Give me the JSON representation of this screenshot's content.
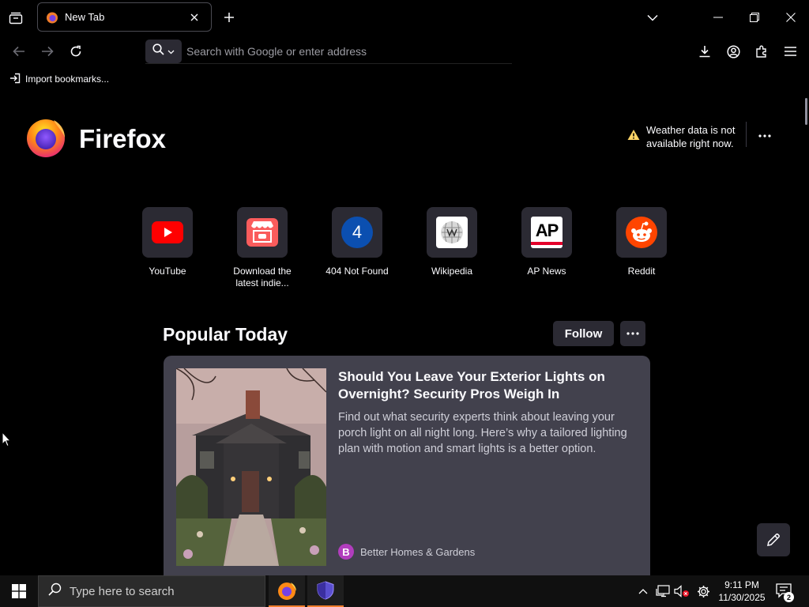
{
  "tabs": [
    {
      "title": "New Tab"
    }
  ],
  "urlbar": {
    "placeholder": "Search with Google or enter address"
  },
  "bookmarks": {
    "import_label": "Import bookmarks..."
  },
  "brand": {
    "wordmark": "Firefox"
  },
  "weather": {
    "message": "Weather data is not available right now."
  },
  "shortcuts": [
    {
      "label": "YouTube",
      "icon": "youtube-icon"
    },
    {
      "label": "Download the latest indie...",
      "icon": "store-icon"
    },
    {
      "label": "404 Not Found",
      "icon": "letter-4-icon",
      "glyph": "4"
    },
    {
      "label": "Wikipedia",
      "icon": "wikipedia-icon"
    },
    {
      "label": "AP News",
      "icon": "ap-news-icon",
      "glyph": "AP"
    },
    {
      "label": "Reddit",
      "icon": "reddit-icon"
    }
  ],
  "popular": {
    "title": "Popular Today",
    "follow_label": "Follow",
    "story": {
      "headline": "Should You Leave Your Exterior Lights on Overnight? Security Pros Weigh In",
      "excerpt": "Find out what security experts think about leaving your porch light on all night long. Here’s why a tailored lighting plan with motion and smart lights is a better option.",
      "source": "Better Homes & Gardens",
      "source_badge": "B"
    }
  },
  "taskbar": {
    "search_placeholder": "Type here to search",
    "time": "9:11 PM",
    "date": "11/30/2025",
    "notification_count": "2"
  },
  "colors": {
    "background": "#000000",
    "tile": "#2b2a33",
    "card": "#42414d",
    "youtube": "#ff0000",
    "reddit": "#ff4500",
    "firefox_orange": "#f07d2b"
  }
}
